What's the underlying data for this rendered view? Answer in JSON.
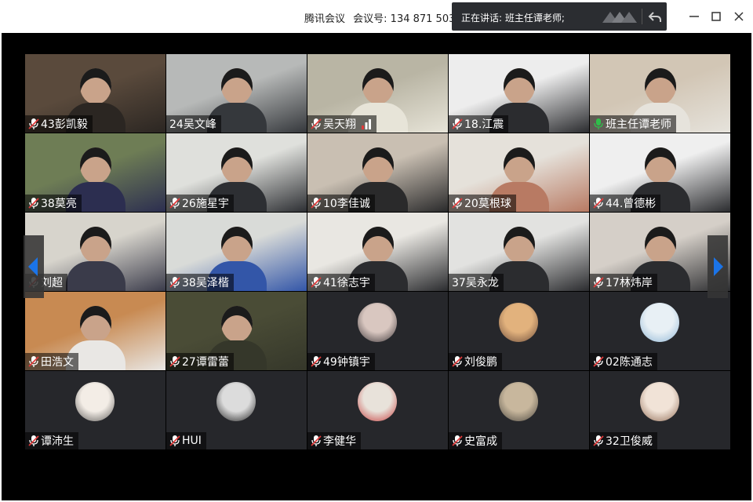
{
  "titlebar": {
    "app_name": "腾讯会议",
    "meeting_id_label": "会议号: 134 871 503"
  },
  "speaking_popup": {
    "text": "正在讲话: 班主任谭老师;"
  },
  "participants": [
    {
      "name": "43彭凯毅",
      "mic": "muted",
      "kind": "video",
      "tone": [
        "#5a4a3c",
        "#2b2622"
      ]
    },
    {
      "name": "24吴文峰",
      "mic": "none",
      "kind": "video",
      "tone": [
        "#b7b9b8",
        "#35383c"
      ]
    },
    {
      "name": "吴天翔",
      "mic": "muted",
      "kind": "video",
      "tone": [
        "#b9b5a4",
        "#e7e4d8"
      ],
      "signal": true
    },
    {
      "name": "18.江震",
      "mic": "muted",
      "kind": "video",
      "tone": [
        "#ededed",
        "#2b2c2f"
      ]
    },
    {
      "name": "班主任谭老师",
      "mic": "active",
      "kind": "video",
      "tone": [
        "#d2c6b5",
        "#e6e3dc"
      ]
    },
    {
      "name": "38莫亮",
      "mic": "muted",
      "kind": "video",
      "tone": [
        "#6e7d55",
        "#2c2e50"
      ]
    },
    {
      "name": "26施星宇",
      "mic": "muted",
      "kind": "video",
      "tone": [
        "#dfe0dc",
        "#2d2f33"
      ]
    },
    {
      "name": "10李佳诚",
      "mic": "muted",
      "kind": "video",
      "tone": [
        "#c9bfb2",
        "#2a2a2b"
      ]
    },
    {
      "name": "20莫根球",
      "mic": "muted",
      "kind": "video",
      "tone": [
        "#e5e1da",
        "#b87a63"
      ]
    },
    {
      "name": "44.曾德彬",
      "mic": "muted",
      "kind": "video",
      "tone": [
        "#efefef",
        "#2b2c2f"
      ]
    },
    {
      "name": "刘超",
      "mic": "muted",
      "kind": "video",
      "tone": [
        "#d7d4cc",
        "#3a3b4a"
      ]
    },
    {
      "name": "38吴泽楷",
      "mic": "muted",
      "kind": "video",
      "tone": [
        "#d9dbd8",
        "#3356a8"
      ]
    },
    {
      "name": "41徐志宇",
      "mic": "muted",
      "kind": "video",
      "tone": [
        "#e9e7e2",
        "#2b2c2f"
      ]
    },
    {
      "name": "37吴永龙",
      "mic": "none",
      "kind": "video",
      "tone": [
        "#e2e2e0",
        "#2b2c2f"
      ]
    },
    {
      "name": "17林炜岸",
      "mic": "muted",
      "kind": "video",
      "tone": [
        "#d5cfc8",
        "#2b2c2f"
      ]
    },
    {
      "name": "田浩文",
      "mic": "muted",
      "kind": "video",
      "tone": [
        "#c88a52",
        "#e9e7e4"
      ]
    },
    {
      "name": "27谭雷蕾",
      "mic": "muted",
      "kind": "video",
      "tone": [
        "#4a4c36",
        "#35372a"
      ]
    },
    {
      "name": "49钟镇宇",
      "mic": "muted",
      "kind": "avatar",
      "tone": [
        "#d9c7c0",
        "#3b3538"
      ]
    },
    {
      "name": "刘俊鹏",
      "mic": "muted",
      "kind": "avatar",
      "tone": [
        "#e2b27d",
        "#6b4b3a"
      ]
    },
    {
      "name": "02陈通志",
      "mic": "muted",
      "kind": "avatar",
      "tone": [
        "#e8f0f5",
        "#8fb6d6"
      ]
    },
    {
      "name": "谭沛生",
      "mic": "muted",
      "kind": "avatar",
      "tone": [
        "#f3ede6",
        "#5c5a58"
      ]
    },
    {
      "name": "HUI",
      "mic": "muted",
      "kind": "avatar",
      "tone": [
        "#dcdcdc",
        "#1e1e1e"
      ]
    },
    {
      "name": "李健华",
      "mic": "muted",
      "kind": "avatar",
      "tone": [
        "#e8e2da",
        "#c63a3a"
      ]
    },
    {
      "name": "史富成",
      "mic": "muted",
      "kind": "avatar",
      "tone": [
        "#c8b79d",
        "#4a463f"
      ]
    },
    {
      "name": "32卫俊威",
      "mic": "muted",
      "kind": "avatar",
      "tone": [
        "#f1e3d7",
        "#8f6b55"
      ]
    }
  ],
  "colors": {
    "mic_muted": "#e03b3b",
    "mic_active": "#2fbf4a",
    "nav_arrow": "#1b74e8",
    "tile_bg": "#26272b"
  }
}
